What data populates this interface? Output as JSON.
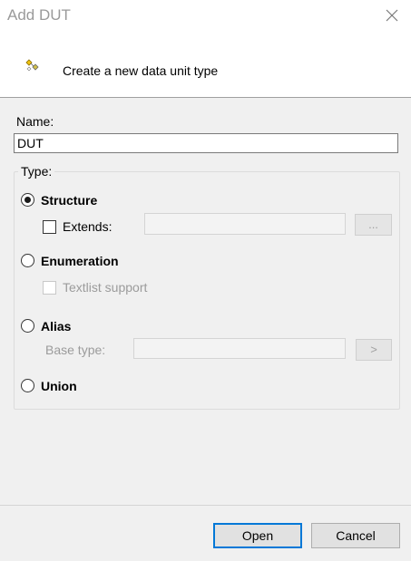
{
  "window": {
    "title": "Add DUT",
    "close_icon": "close-icon"
  },
  "header": {
    "icon": "new-dut-icon",
    "text": "Create a new data unit type"
  },
  "name": {
    "label": "Name:",
    "value": "DUT"
  },
  "type_group": {
    "legend": "Type:",
    "options": [
      {
        "label": "Structure",
        "checked": true
      },
      {
        "label": "Enumeration",
        "checked": false
      },
      {
        "label": "Alias",
        "checked": false
      },
      {
        "label": "Union",
        "checked": false
      }
    ],
    "extends": {
      "label": "Extends:",
      "value": "",
      "browse_label": "..."
    },
    "textlist_support": {
      "label": "Textlist support",
      "enabled": false
    },
    "base_type": {
      "label": "Base type:",
      "value": "",
      "browse_label": ">"
    }
  },
  "buttons": {
    "open": "Open",
    "cancel": "Cancel"
  },
  "colors": {
    "accent": "#0078d7",
    "disabled_text": "#9b9b9b",
    "background": "#f0f0f0"
  }
}
